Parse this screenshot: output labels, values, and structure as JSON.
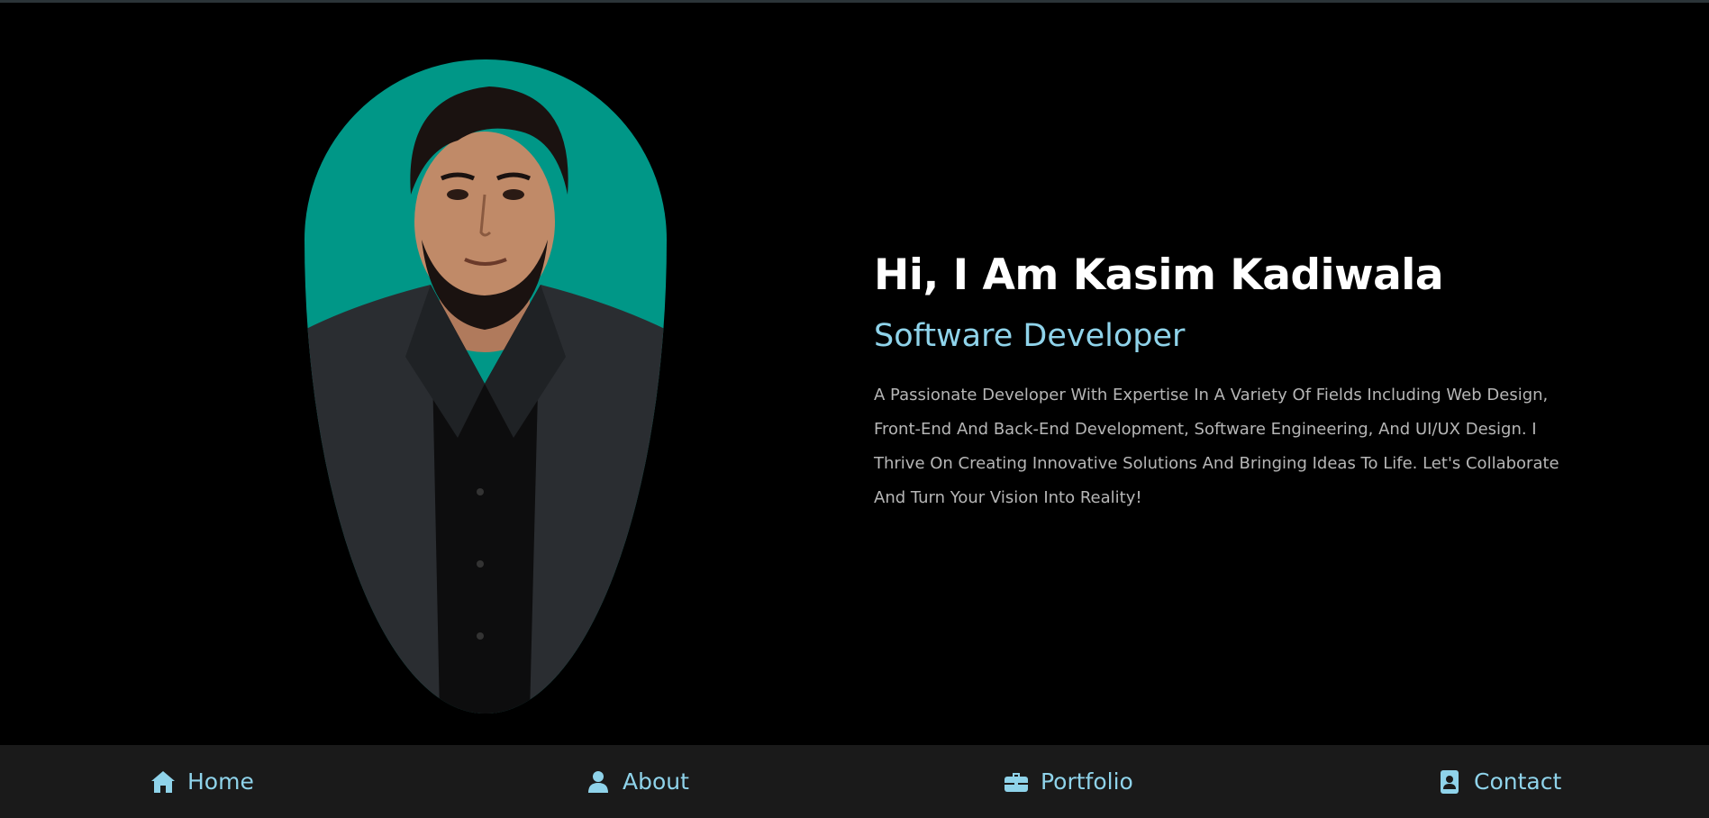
{
  "hero": {
    "title": "Hi, I Am Kasim Kadiwala",
    "role": "Software Developer",
    "description": "A Passionate Developer With Expertise In A Variety Of Fields Including Web Design, Front-End And Back-End Development, Software Engineering, And UI/UX Design. I Thrive On Creating Innovative Solutions And Bringing Ideas To Life. Let's Collaborate And Turn Your Vision Into Reality!"
  },
  "nav": {
    "items": [
      {
        "label": "Home",
        "icon": "home-icon"
      },
      {
        "label": "About",
        "icon": "user-icon"
      },
      {
        "label": "Portfolio",
        "icon": "briefcase-icon"
      },
      {
        "label": "Contact",
        "icon": "address-book-icon"
      }
    ]
  },
  "colors": {
    "background": "#000000",
    "accent": "#8fd3ea",
    "portrait_background": "#009787",
    "nav_background": "#1a1a1a",
    "description_text": "#b6b6b6"
  }
}
